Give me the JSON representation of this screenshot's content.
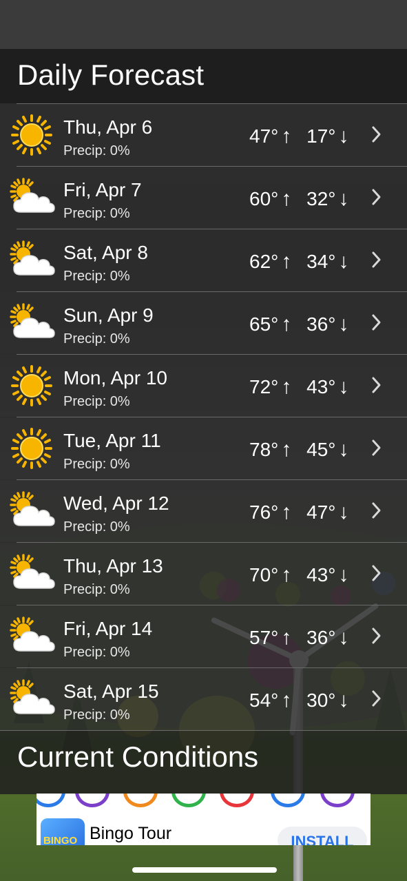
{
  "header": {
    "title": "Daily Forecast"
  },
  "forecast": [
    {
      "day": "Thu, Apr 6",
      "precip": "Precip: 0%",
      "high": "47°",
      "low": "17°",
      "icon": "sun-icon"
    },
    {
      "day": "Fri, Apr 7",
      "precip": "Precip: 0%",
      "high": "60°",
      "low": "32°",
      "icon": "partly-cloudy-icon"
    },
    {
      "day": "Sat, Apr 8",
      "precip": "Precip: 0%",
      "high": "62°",
      "low": "34°",
      "icon": "partly-cloudy-icon"
    },
    {
      "day": "Sun, Apr 9",
      "precip": "Precip: 0%",
      "high": "65°",
      "low": "36°",
      "icon": "partly-cloudy-icon"
    },
    {
      "day": "Mon, Apr 10",
      "precip": "Precip: 0%",
      "high": "72°",
      "low": "43°",
      "icon": "sun-icon"
    },
    {
      "day": "Tue, Apr 11",
      "precip": "Precip: 0%",
      "high": "78°",
      "low": "45°",
      "icon": "sun-icon"
    },
    {
      "day": "Wed, Apr 12",
      "precip": "Precip: 0%",
      "high": "76°",
      "low": "47°",
      "icon": "partly-cloudy-icon"
    },
    {
      "day": "Thu, Apr 13",
      "precip": "Precip: 0%",
      "high": "70°",
      "low": "43°",
      "icon": "partly-cloudy-icon"
    },
    {
      "day": "Fri, Apr 14",
      "precip": "Precip: 0%",
      "high": "57°",
      "low": "36°",
      "icon": "partly-cloudy-icon"
    },
    {
      "day": "Sat, Apr 15",
      "precip": "Precip: 0%",
      "high": "54°",
      "low": "30°",
      "icon": "partly-cloudy-icon"
    }
  ],
  "arrows": {
    "up": "↑",
    "down": "↓"
  },
  "current": {
    "title": "Current Conditions"
  },
  "ad": {
    "app_name": "Bingo Tour",
    "install_label": "INSTALL",
    "icon_text": "BINGO"
  },
  "colors": {
    "sun": "#f7b500",
    "cloud": "#ffffff",
    "ad_button_text": "#2a74e8"
  }
}
